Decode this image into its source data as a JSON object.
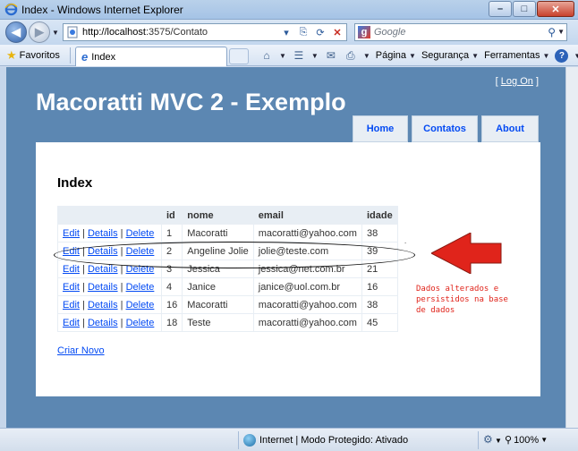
{
  "window": {
    "title": "Index - Windows Internet Explorer",
    "minimize": "–",
    "maximize": "□",
    "close": "✕"
  },
  "address": {
    "url_host": "http://localhost",
    "url_path": ":3575/Contato",
    "search_placeholder": "Google"
  },
  "favorites": {
    "label": "Favoritos",
    "tab_title": "Index"
  },
  "commandbar": {
    "page": "Página",
    "security": "Segurança",
    "tools": "Ferramentas"
  },
  "site": {
    "login_open": "[",
    "login_link": "Log On",
    "login_close": "]",
    "title": "Macoratti MVC 2 - Exemplo",
    "menu": {
      "home": "Home",
      "contatos": "Contatos",
      "about": "About"
    },
    "heading": "Index",
    "table": {
      "headers": [
        "",
        "id",
        "nome",
        "email",
        "idade"
      ],
      "actions": {
        "edit": "Edit",
        "details": "Details",
        "delete": "Delete",
        "sep": "|"
      },
      "rows": [
        {
          "id": "1",
          "nome": "Macoratti",
          "email": "macoratti@yahoo.com",
          "idade": "38"
        },
        {
          "id": "2",
          "nome": "Angeline Jolie",
          "email": "jolie@teste.com",
          "idade": "39"
        },
        {
          "id": "3",
          "nome": "Jessica",
          "email": "jessica@net.com.br",
          "idade": "21"
        },
        {
          "id": "4",
          "nome": "Janice",
          "email": "janice@uol.com.br",
          "idade": "16"
        },
        {
          "id": "16",
          "nome": "Macoratti",
          "email": "macoratti@yahoo.com",
          "idade": "38"
        },
        {
          "id": "18",
          "nome": "Teste",
          "email": "macoratti@yahoo.com",
          "idade": "45"
        }
      ]
    },
    "create_link": "Criar Novo"
  },
  "annotation": {
    "note_line1": "Dados alterados e",
    "note_line2": "persistidos na base",
    "note_line3": "de dados",
    "arrow_color": "#e0241b"
  },
  "status": {
    "zone": "Internet | Modo Protegido: Ativado",
    "zoom": "100%"
  }
}
